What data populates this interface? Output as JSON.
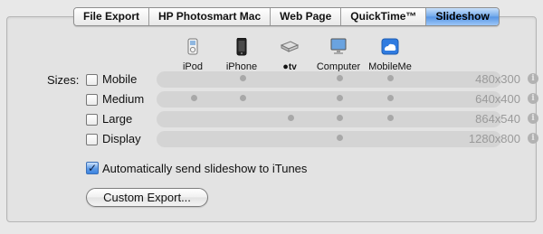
{
  "tabs": [
    {
      "label": "File Export"
    },
    {
      "label": "HP Photosmart Mac"
    },
    {
      "label": "Web Page"
    },
    {
      "label": "QuickTime™"
    },
    {
      "label": "Slideshow",
      "active": true
    }
  ],
  "devices": [
    {
      "label": "iPod",
      "icon": "ipod-icon"
    },
    {
      "label": "iPhone",
      "icon": "iphone-icon"
    },
    {
      "label": "tv",
      "icon": "apple-tv-icon",
      "prefix": ""
    },
    {
      "label": "Computer",
      "icon": "computer-icon"
    },
    {
      "label": "MobileMe",
      "icon": "mobileme-icon"
    }
  ],
  "sizes_label": "Sizes:",
  "sizes": [
    {
      "name": "Mobile",
      "resolution": "480x300",
      "checked": false,
      "supported": [
        false,
        true,
        false,
        true,
        true
      ]
    },
    {
      "name": "Medium",
      "resolution": "640x400",
      "checked": false,
      "supported": [
        true,
        true,
        false,
        true,
        true
      ]
    },
    {
      "name": "Large",
      "resolution": "864x540",
      "checked": false,
      "supported": [
        false,
        false,
        true,
        true,
        true
      ]
    },
    {
      "name": "Display",
      "resolution": "1280x800",
      "checked": false,
      "supported": [
        false,
        false,
        false,
        true,
        false
      ]
    }
  ],
  "itunes": {
    "label": "Automatically send slideshow to iTunes",
    "checked": true
  },
  "custom_export_label": "Custom Export...",
  "colors": {
    "active_tab": "#5795e4",
    "dot": "#a8a8a8",
    "row_bar": "#d4d4d4"
  }
}
